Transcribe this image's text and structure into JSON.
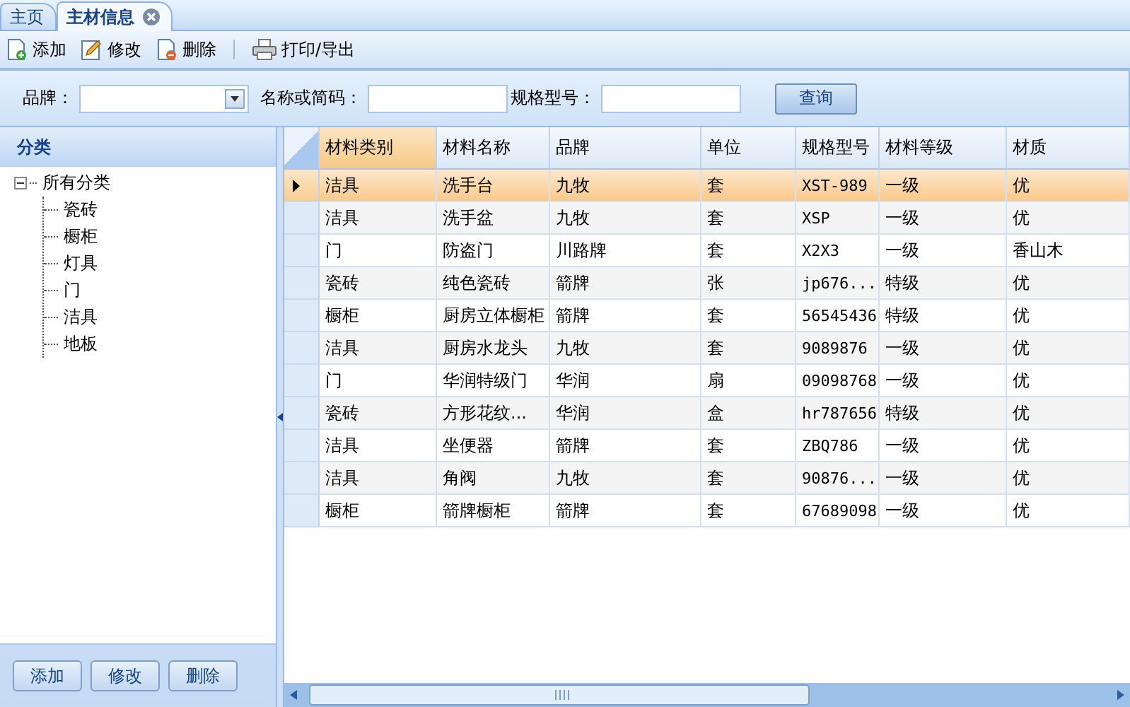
{
  "tabs": [
    {
      "label": "主页",
      "selected": false,
      "closable": false
    },
    {
      "label": "主材信息",
      "selected": true,
      "closable": true
    }
  ],
  "toolbar": [
    {
      "label": "添加",
      "kind": "add"
    },
    {
      "label": "修改",
      "kind": "edit"
    },
    {
      "label": "删除",
      "kind": "delete"
    },
    {
      "label": "打印/导出",
      "kind": "print"
    }
  ],
  "filters": {
    "brand_label": "品牌：",
    "name_label": "名称或简码：",
    "spec_label": "规格型号：",
    "search_button": "查询"
  },
  "sidebar": {
    "title": "分类",
    "tree": {
      "label": "所有分类",
      "expanded": true,
      "children": [
        {
          "label": "瓷砖"
        },
        {
          "label": "橱柜"
        },
        {
          "label": "灯具"
        },
        {
          "label": "门"
        },
        {
          "label": "洁具"
        },
        {
          "label": "地板"
        }
      ]
    },
    "buttons": [
      "添加",
      "修改",
      "删除"
    ]
  },
  "table": {
    "columns": [
      "材料类别",
      "材料名称",
      "品牌",
      "单位",
      "规格型号",
      "材料等级",
      "材质"
    ],
    "rows": [
      {
        "selected": true,
        "cells": [
          "洁具",
          "洗手台",
          "九牧",
          "套",
          "XST-989",
          "一级",
          "优"
        ]
      },
      {
        "selected": false,
        "cells": [
          "洁具",
          "洗手盆",
          "九牧",
          "套",
          "XSP",
          "一级",
          "优"
        ]
      },
      {
        "selected": false,
        "cells": [
          "门",
          "防盗门",
          "川路牌",
          "套",
          "X2X3",
          "一级",
          "香山木"
        ]
      },
      {
        "selected": false,
        "cells": [
          "瓷砖",
          "纯色瓷砖",
          "箭牌",
          "张",
          "jp676...",
          "特级",
          "优"
        ]
      },
      {
        "selected": false,
        "cells": [
          "橱柜",
          "厨房立体橱柜",
          "箭牌",
          "套",
          "56545436",
          "特级",
          "优"
        ]
      },
      {
        "selected": false,
        "cells": [
          "洁具",
          "厨房水龙头",
          "九牧",
          "套",
          "9089876",
          "一级",
          "优"
        ]
      },
      {
        "selected": false,
        "cells": [
          "门",
          "华润特级门",
          "华润",
          "扇",
          "09098768",
          "一级",
          "优"
        ]
      },
      {
        "selected": false,
        "cells": [
          "瓷砖",
          "方形花纹...",
          "华润",
          "盒",
          "hr787656",
          "特级",
          "优"
        ]
      },
      {
        "selected": false,
        "cells": [
          "洁具",
          "坐便器",
          "箭牌",
          "套",
          "ZBQ786",
          "一级",
          "优"
        ]
      },
      {
        "selected": false,
        "cells": [
          "洁具",
          "角阀",
          "九牧",
          "套",
          "90876...",
          "一级",
          "优"
        ]
      },
      {
        "selected": false,
        "cells": [
          "橱柜",
          "箭牌橱柜",
          "箭牌",
          "套",
          "67689098",
          "一级",
          "优"
        ]
      }
    ]
  }
}
